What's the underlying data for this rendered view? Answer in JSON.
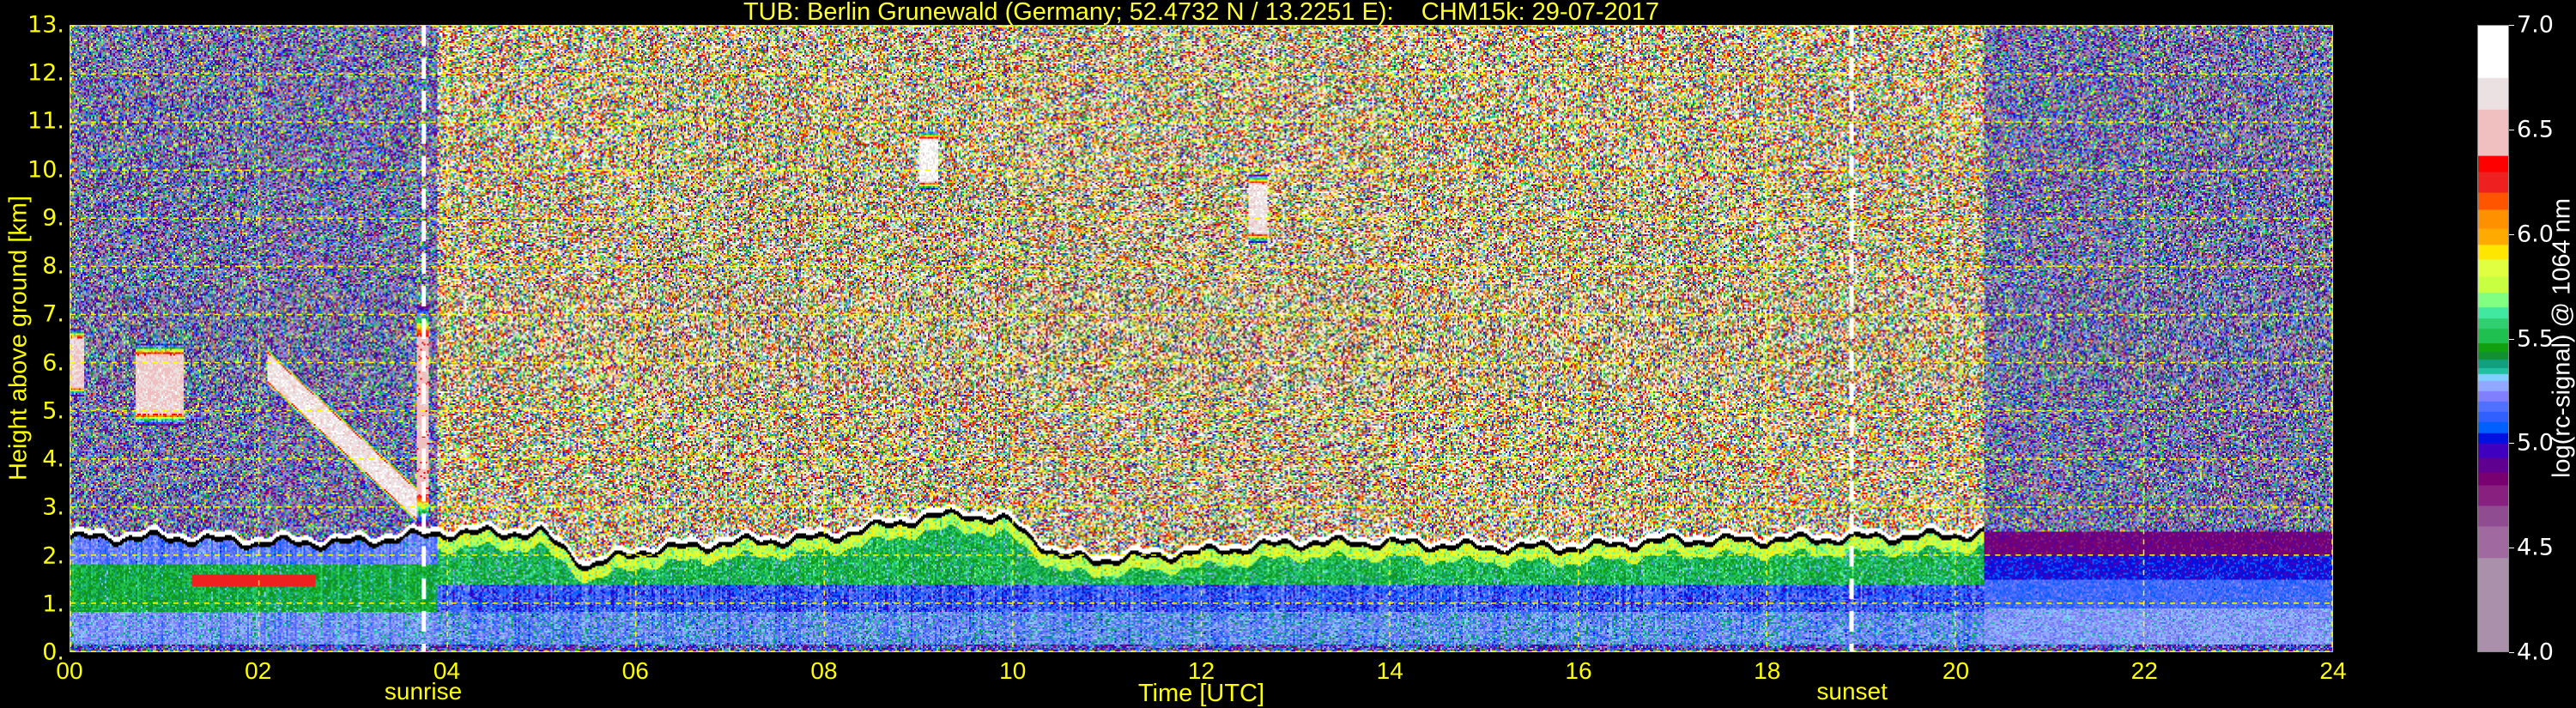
{
  "title": "TUB: Berlin Grunewald (Germany; 52.4732 N / 13.2251 E):    CHM15k: 29-07-2017",
  "chart_data": {
    "type": "heatmap",
    "title": "TUB: Berlin Grunewald (Germany; 52.4732 N / 13.2251 E):    CHM15k: 29-07-2017",
    "xlabel": "Time [UTC]",
    "ylabel": "Height above ground [km]",
    "xlim": [
      0,
      24
    ],
    "ylim": [
      0,
      13
    ],
    "grid": true,
    "x_ticks": [
      0,
      2,
      4,
      6,
      8,
      10,
      12,
      14,
      16,
      18,
      20,
      22,
      24
    ],
    "x_tick_labels": [
      "00",
      "02",
      "04",
      "06",
      "08",
      "10",
      "12",
      "14",
      "16",
      "18",
      "20",
      "22",
      "24"
    ],
    "y_ticks": [
      0,
      1,
      2,
      3,
      4,
      5,
      6,
      7,
      8,
      9,
      10,
      11,
      12,
      13
    ],
    "y_tick_labels": [
      "0.",
      "1.",
      "2.",
      "3.",
      "4.",
      "5.",
      "6.",
      "7.",
      "8.",
      "9.",
      "10.",
      "11.",
      "12.",
      "13."
    ],
    "annotations": [
      {
        "label": "sunrise",
        "time": 3.75
      },
      {
        "label": "sunset",
        "time": 18.9
      }
    ],
    "colorbar": {
      "label": "log(rc-signal) @ 1064 nm",
      "range": [
        4.0,
        7.0
      ],
      "ticks": [
        4.0,
        4.5,
        5.0,
        5.5,
        6.0,
        6.5,
        7.0
      ],
      "tick_labels": [
        "4.0",
        "4.5",
        "5.0",
        "5.5",
        "6.0",
        "6.5",
        "7.0"
      ],
      "levels": [
        {
          "from": 4.0,
          "to": 4.45,
          "color": "#aa90aa"
        },
        {
          "from": 4.45,
          "to": 4.6,
          "color": "#a06aa0"
        },
        {
          "from": 4.6,
          "to": 4.7,
          "color": "#904c90"
        },
        {
          "from": 4.7,
          "to": 4.8,
          "color": "#882080"
        },
        {
          "from": 4.8,
          "to": 4.86,
          "color": "#780070"
        },
        {
          "from": 4.86,
          "to": 4.93,
          "color": "#600090"
        },
        {
          "from": 4.93,
          "to": 5.0,
          "color": "#4000c0"
        },
        {
          "from": 5.0,
          "to": 5.05,
          "color": "#0010e0"
        },
        {
          "from": 5.05,
          "to": 5.1,
          "color": "#0060ff"
        },
        {
          "from": 5.1,
          "to": 5.15,
          "color": "#3060ff"
        },
        {
          "from": 5.15,
          "to": 5.2,
          "color": "#5070ff"
        },
        {
          "from": 5.2,
          "to": 5.25,
          "color": "#8080ff"
        },
        {
          "from": 5.25,
          "to": 5.3,
          "color": "#90a8ff"
        },
        {
          "from": 5.3,
          "to": 5.33,
          "color": "#80d0ff"
        },
        {
          "from": 5.33,
          "to": 5.36,
          "color": "#20c0a0"
        },
        {
          "from": 5.36,
          "to": 5.4,
          "color": "#10a080"
        },
        {
          "from": 5.4,
          "to": 5.44,
          "color": "#109030"
        },
        {
          "from": 5.44,
          "to": 5.48,
          "color": "#10a010"
        },
        {
          "from": 5.48,
          "to": 5.55,
          "color": "#20c050"
        },
        {
          "from": 5.55,
          "to": 5.6,
          "color": "#30d070"
        },
        {
          "from": 5.6,
          "to": 5.65,
          "color": "#40e8a0"
        },
        {
          "from": 5.65,
          "to": 5.72,
          "color": "#80ff80"
        },
        {
          "from": 5.72,
          "to": 5.8,
          "color": "#c8ff40"
        },
        {
          "from": 5.8,
          "to": 5.88,
          "color": "#e0ff40"
        },
        {
          "from": 5.88,
          "to": 5.95,
          "color": "#ffe600"
        },
        {
          "from": 5.95,
          "to": 6.03,
          "color": "#ffaa00"
        },
        {
          "from": 6.03,
          "to": 6.12,
          "color": "#ff9000"
        },
        {
          "from": 6.12,
          "to": 6.2,
          "color": "#ff5500"
        },
        {
          "from": 6.2,
          "to": 6.3,
          "color": "#ee2020"
        },
        {
          "from": 6.3,
          "to": 6.38,
          "color": "#ff0000"
        },
        {
          "from": 6.38,
          "to": 6.6,
          "color": "#f0c0c0"
        },
        {
          "from": 6.6,
          "to": 6.75,
          "color": "#ebe0e2"
        },
        {
          "from": 6.75,
          "to": 7.0,
          "color": "#ffffff"
        }
      ]
    },
    "boundary_layer_top_km": {
      "time": [
        0,
        1,
        2,
        3,
        4,
        5,
        5.5,
        6,
        7,
        8,
        9,
        9.5,
        10,
        10.5,
        11,
        12,
        13,
        14,
        15,
        16,
        17,
        18,
        19,
        20,
        20.3
      ],
      "height": [
        2.4,
        2.4,
        2.3,
        2.3,
        2.5,
        2.5,
        1.8,
        2.1,
        2.3,
        2.4,
        2.8,
        2.9,
        2.7,
        2.0,
        1.95,
        2.1,
        2.3,
        2.3,
        2.2,
        2.2,
        2.35,
        2.35,
        2.4,
        2.45,
        2.5
      ]
    },
    "cloud_layers": [
      {
        "t_start": 0.0,
        "t_end": 0.15,
        "h_bottom": 5.3,
        "h_top": 6.7,
        "value": 6.6
      },
      {
        "t_start": 0.7,
        "t_end": 1.2,
        "h_bottom": 4.7,
        "h_top": 6.4,
        "value": 6.6
      },
      {
        "t_start": 2.1,
        "t_end": 3.7,
        "h_bottom_start": 5.5,
        "h_bottom_end": 2.6,
        "thickness": 0.8,
        "value": 6.7
      },
      {
        "t_start": 3.68,
        "t_end": 3.8,
        "h_bottom": 2.6,
        "h_top": 7.2,
        "value": 6.5
      },
      {
        "t_start": 9.0,
        "t_end": 9.2,
        "h_bottom": 9.6,
        "h_top": 10.8,
        "value": 6.8
      },
      {
        "t_start": 12.5,
        "t_end": 12.7,
        "h_bottom": 8.5,
        "h_top": 9.9,
        "value": 6.7
      }
    ],
    "background_noise": {
      "night_mean": 5.0,
      "night_sd": 0.5,
      "day_mean": 6.0,
      "day_sd": 0.7
    },
    "colors": {
      "text": "#ffff00",
      "grid": "#ffff00",
      "marker_lines": "#ffffff"
    }
  }
}
